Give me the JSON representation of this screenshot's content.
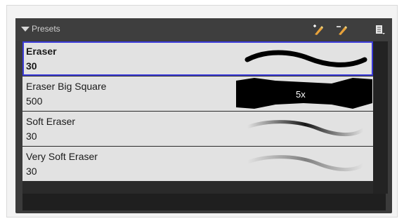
{
  "panel": {
    "title": "Presets"
  },
  "toolbar": {
    "new_preset_icon": "add-preset-icon",
    "rename_preset_icon": "rename-preset-icon",
    "menu_icon": "menu-icon"
  },
  "presets": [
    {
      "name": "Eraser",
      "size": "30",
      "selected": true
    },
    {
      "name": "Eraser Big Square",
      "size": "500",
      "preview_label": "5x"
    },
    {
      "name": "Soft Eraser",
      "size": "30"
    },
    {
      "name": "Very Soft Eraser",
      "size": "30"
    }
  ],
  "colors": {
    "selection_border": "#3b3bd9",
    "row_bg": "#e2e2e2",
    "panel_bg": "#3b3b3b",
    "accent_icon": "#e8a23a"
  }
}
